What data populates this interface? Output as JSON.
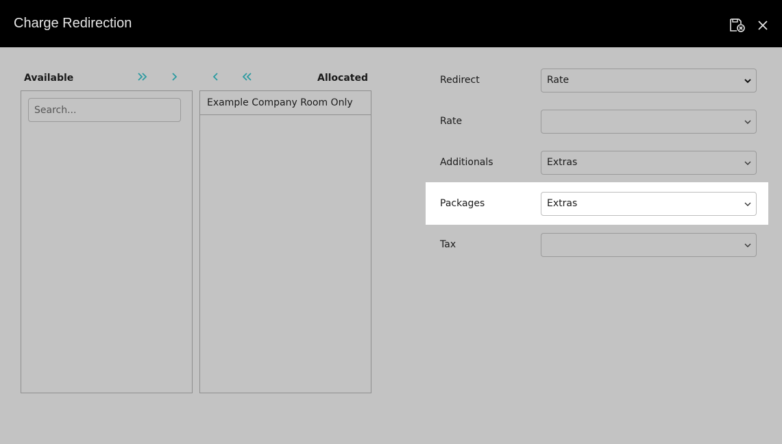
{
  "dialog": {
    "title": "Charge Redirection"
  },
  "header_icons": {
    "save": "save-cancel-icon",
    "close": "close-icon"
  },
  "lists": {
    "available_label": "Available",
    "allocated_label": "Allocated",
    "search_placeholder": "Search...",
    "search_value": "",
    "available_items": [],
    "allocated_items": [
      "Example Company Room Only"
    ],
    "arrow_icons": [
      "double-chevron-right-icon",
      "chevron-right-icon",
      "chevron-left-icon",
      "double-chevron-left-icon"
    ]
  },
  "form": {
    "fields": [
      {
        "label": "Redirect",
        "value": "Rate",
        "highlighted": false
      },
      {
        "label": "Rate",
        "value": "",
        "highlighted": false
      },
      {
        "label": "Additionals",
        "value": "Extras",
        "highlighted": false
      },
      {
        "label": "Packages",
        "value": "Extras",
        "highlighted": true
      },
      {
        "label": "Tax",
        "value": "",
        "highlighted": false
      }
    ]
  },
  "colors": {
    "header_bg": "#000000",
    "body_bg": "#c3c3c3",
    "accent": "#2a9aa0",
    "highlight_bg": "#ffffff"
  }
}
